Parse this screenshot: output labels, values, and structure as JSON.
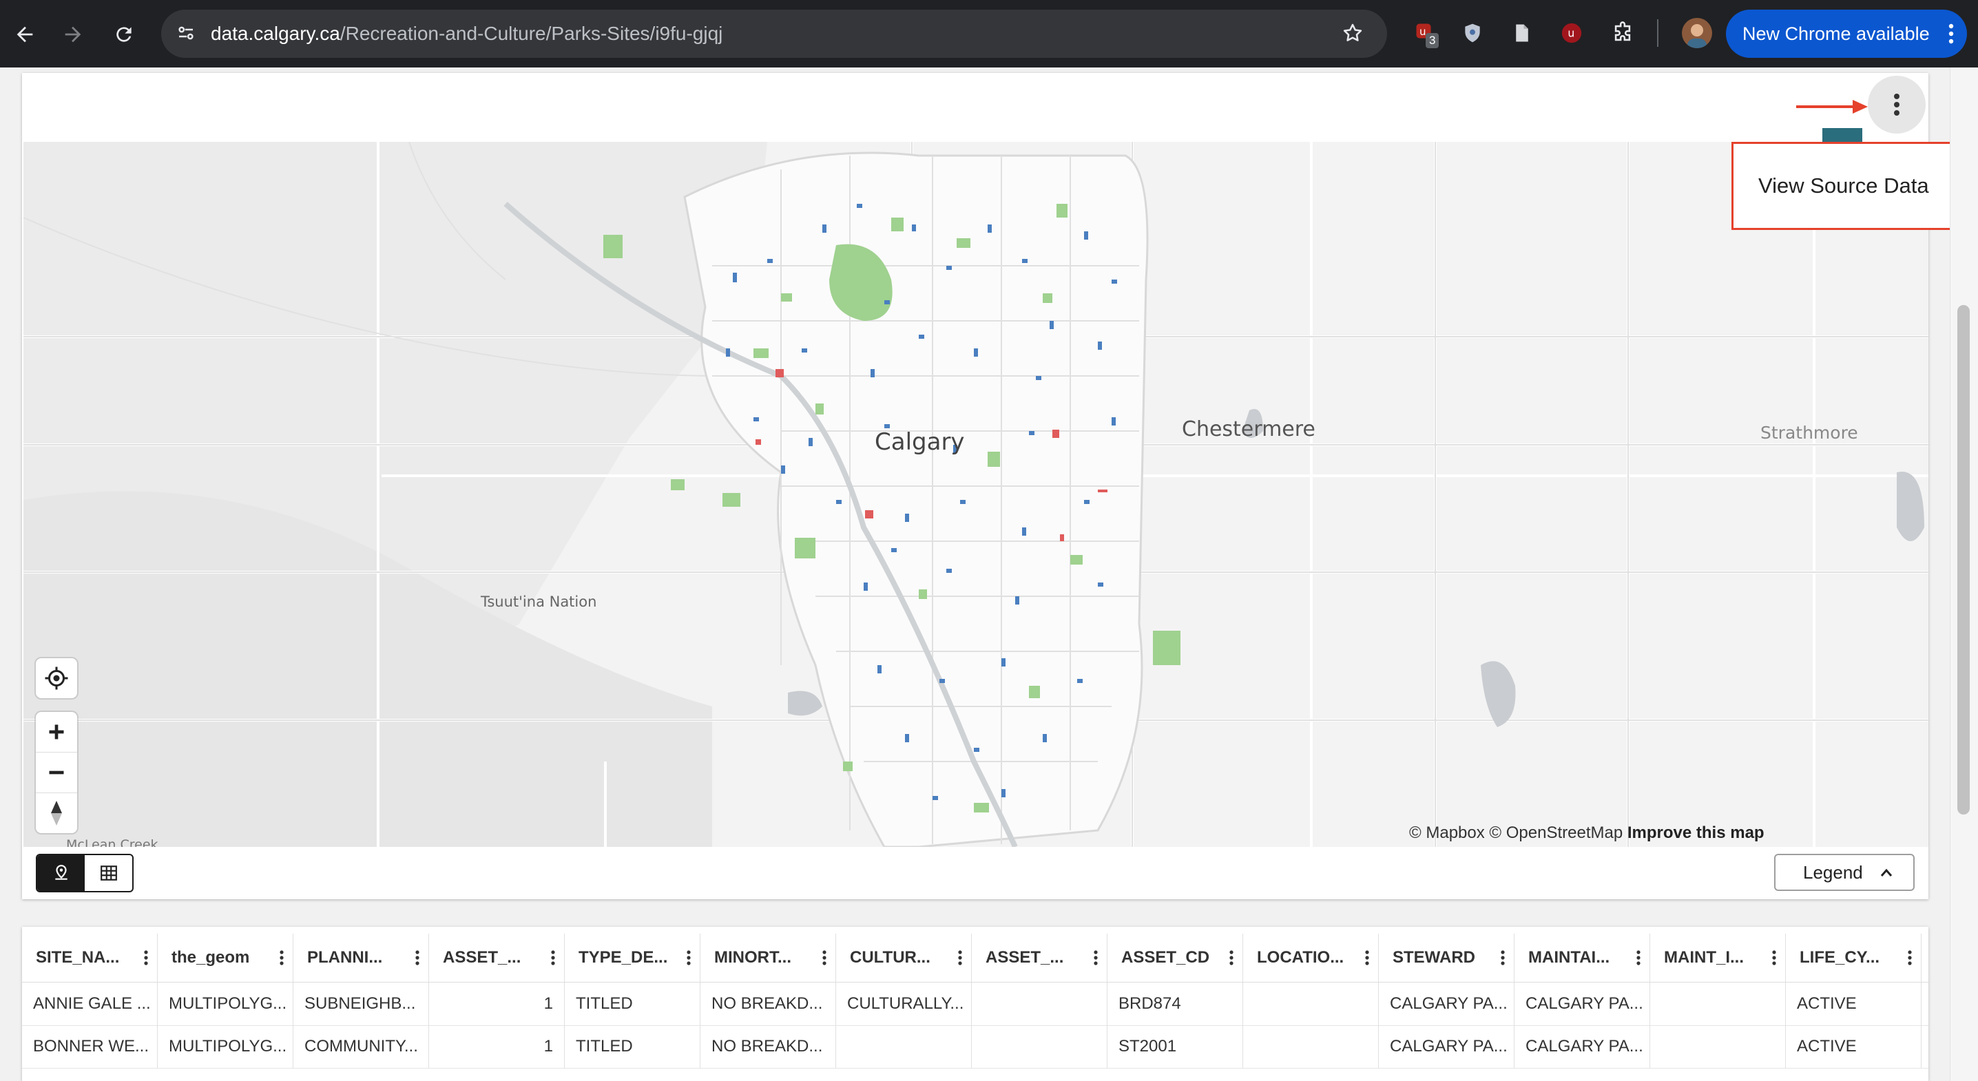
{
  "browser": {
    "url_host": "data.calgary.ca",
    "url_path": "/Recreation-and-Culture/Parks-Sites/i9fu-gjqj",
    "update_button_label": "New Chrome available",
    "extension_badge_count": "3",
    "icons": [
      "back-icon",
      "forward-icon",
      "reload-icon",
      "site-info-icon",
      "bookmark-star-icon",
      "extension-icon",
      "shield-icon",
      "document-icon",
      "ublock-icon",
      "puzzle-icon",
      "profile-avatar"
    ]
  },
  "card": {
    "menu_item": "View Source Data"
  },
  "map": {
    "labels": {
      "city": "Calgary",
      "chestermere": "Chestermere",
      "strathmore": "Strathmore",
      "tsuutina": "Tsuut'ina Nation",
      "mclean": "McLean Creek"
    },
    "attribution_mapbox": "© Mapbox",
    "attribution_osm": "© OpenStreetMap",
    "attribution_improve": "Improve this map",
    "colors": {
      "park_green": "#9fd18f",
      "asset_blue": "#4a7fc0",
      "asset_red": "#e05b5b",
      "road": "#ffffff",
      "water": "#c9ccd0"
    }
  },
  "controls": {
    "legend_label": "Legend"
  },
  "table": {
    "columns": [
      "SITE_NA...",
      "the_geom",
      "PLANNI...",
      "ASSET_...",
      "TYPE_DE...",
      "MINORT...",
      "CULTUR...",
      "ASSET_...",
      "ASSET_CD",
      "LOCATIO...",
      "STEWARD",
      "MAINTAI...",
      "MAINT_I...",
      "LIFE_CY..."
    ],
    "rows": [
      [
        "ANNIE GALE ...",
        "MULTIPOLYG...",
        "SUBNEIGHB...",
        "1",
        "TITLED",
        "NO BREAKD...",
        "CULTURALLY...",
        "",
        "BRD874",
        "",
        "CALGARY PA...",
        "CALGARY PA...",
        "",
        "ACTIVE"
      ],
      [
        "BONNER WE...",
        "MULTIPOLYG...",
        "COMMUNITY...",
        "1",
        "TITLED",
        "NO BREAKD...",
        "",
        "",
        "ST2001",
        "",
        "CALGARY PA...",
        "CALGARY PA...",
        "",
        "ACTIVE"
      ]
    ]
  }
}
